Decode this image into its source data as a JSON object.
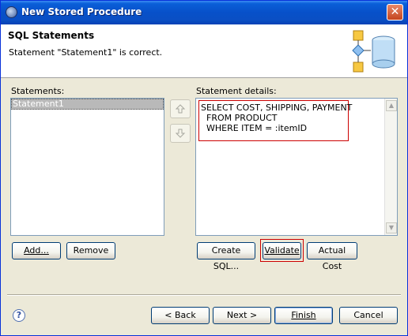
{
  "window": {
    "title": "New Stored Procedure"
  },
  "header": {
    "title": "SQL Statements",
    "message": "Statement \"Statement1\" is correct."
  },
  "statements": {
    "label": "Statements:",
    "items": [
      "Statement1"
    ],
    "selected": "Statement1",
    "add_label": "Add...",
    "remove_label": "Remove"
  },
  "details": {
    "label": "Statement details:",
    "sql_lines": [
      "SELECT COST, SHIPPING, PAYMENT",
      "  FROM PRODUCT",
      "  WHERE ITEM = :itemID"
    ],
    "create_sql_label": "Create SQL...",
    "validate_label": "Validate",
    "actual_cost_label": "Actual Cost"
  },
  "footer": {
    "back_label": "< Back",
    "next_label": "Next >",
    "finish_label": "Finish",
    "cancel_label": "Cancel"
  },
  "icons": {
    "window_icon": "eclipse-icon",
    "close": "close-icon",
    "move_up": "arrow-up-icon",
    "move_down": "arrow-down-icon",
    "help": "help-icon",
    "wizard_banner": "database-flow-icon"
  },
  "colors": {
    "titlebar": "#0a5fd8",
    "highlight_border": "#cc0000",
    "selection": "#b9b9b9"
  }
}
